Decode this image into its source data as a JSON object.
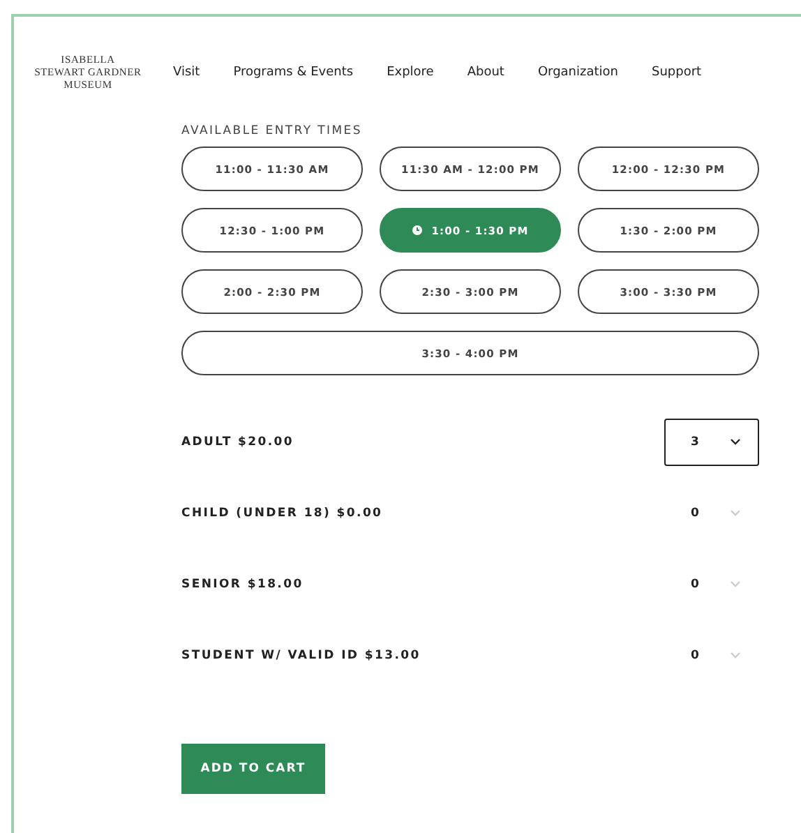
{
  "logo": [
    "ISABELLA",
    "STEWART GARDNER",
    "MUSEUM"
  ],
  "nav": [
    "Visit",
    "Programs & Events",
    "Explore",
    "About",
    "Organization",
    "Support"
  ],
  "entry_times": {
    "heading": "AVAILABLE ENTRY TIMES",
    "slots": [
      {
        "label": "11:00 - 11:30 AM",
        "selected": false
      },
      {
        "label": "11:30 AM - 12:00 PM",
        "selected": false
      },
      {
        "label": "12:00 - 12:30 PM",
        "selected": false
      },
      {
        "label": "12:30 - 1:00 PM",
        "selected": false
      },
      {
        "label": "1:00 - 1:30 PM",
        "selected": true
      },
      {
        "label": "1:30 - 2:00 PM",
        "selected": false
      },
      {
        "label": "2:00 - 2:30 PM",
        "selected": false
      },
      {
        "label": "2:30 - 3:00 PM",
        "selected": false
      },
      {
        "label": "3:00 - 3:30 PM",
        "selected": false
      },
      {
        "label": "3:30 - 4:00 PM",
        "selected": false
      }
    ]
  },
  "tickets": [
    {
      "label": "ADULT $20.00",
      "quantity": "3",
      "focused": true
    },
    {
      "label": "CHILD (UNDER 18) $0.00",
      "quantity": "0",
      "focused": false
    },
    {
      "label": "SENIOR $18.00",
      "quantity": "0",
      "focused": false
    },
    {
      "label": "STUDENT W/ VALID ID $13.00",
      "quantity": "0",
      "focused": false
    }
  ],
  "add_to_cart": "ADD TO CART"
}
